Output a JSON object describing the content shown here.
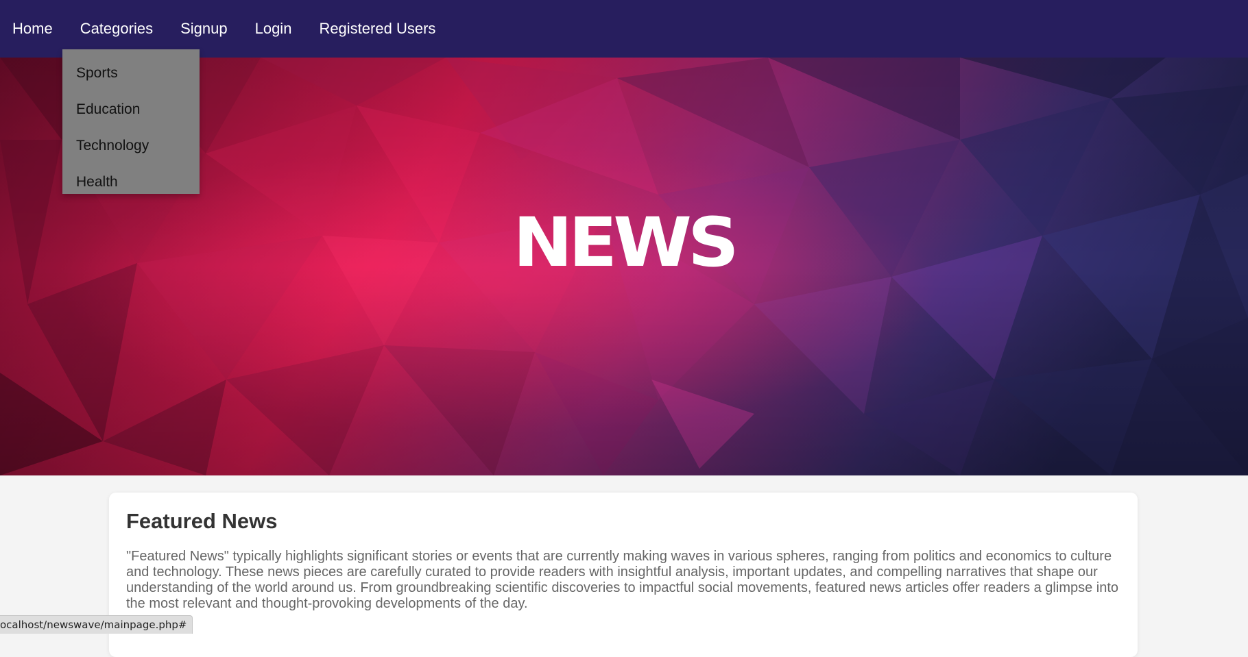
{
  "nav": {
    "items": [
      {
        "label": "Home"
      },
      {
        "label": "Categories"
      },
      {
        "label": "Signup"
      },
      {
        "label": "Login"
      },
      {
        "label": "Registered Users"
      }
    ]
  },
  "categories_menu": {
    "items": [
      {
        "label": "Sports"
      },
      {
        "label": "Education"
      },
      {
        "label": "Technology"
      },
      {
        "label": "Health"
      }
    ]
  },
  "hero": {
    "logo_text": "NEWS"
  },
  "featured": {
    "title": "Featured News",
    "body": "\"Featured News\" typically highlights significant stories or events that are currently making waves in various spheres, ranging from politics and economics to culture and technology. These news pieces are carefully curated to provide readers with insightful analysis, important updates, and compelling narratives that shape our understanding of the world around us. From groundbreaking scientific discoveries to impactful social movements, featured news articles offer readers a glimpse into the most relevant and thought-provoking developments of the day."
  },
  "status_bar": {
    "url": "ocalhost/newswave/mainpage.php#"
  },
  "colors": {
    "navbar": "#271e5e",
    "dropdown": "#808080",
    "hero_left": "#7a0f2e",
    "hero_center": "#e11d55",
    "hero_right": "#2a2a5e"
  }
}
